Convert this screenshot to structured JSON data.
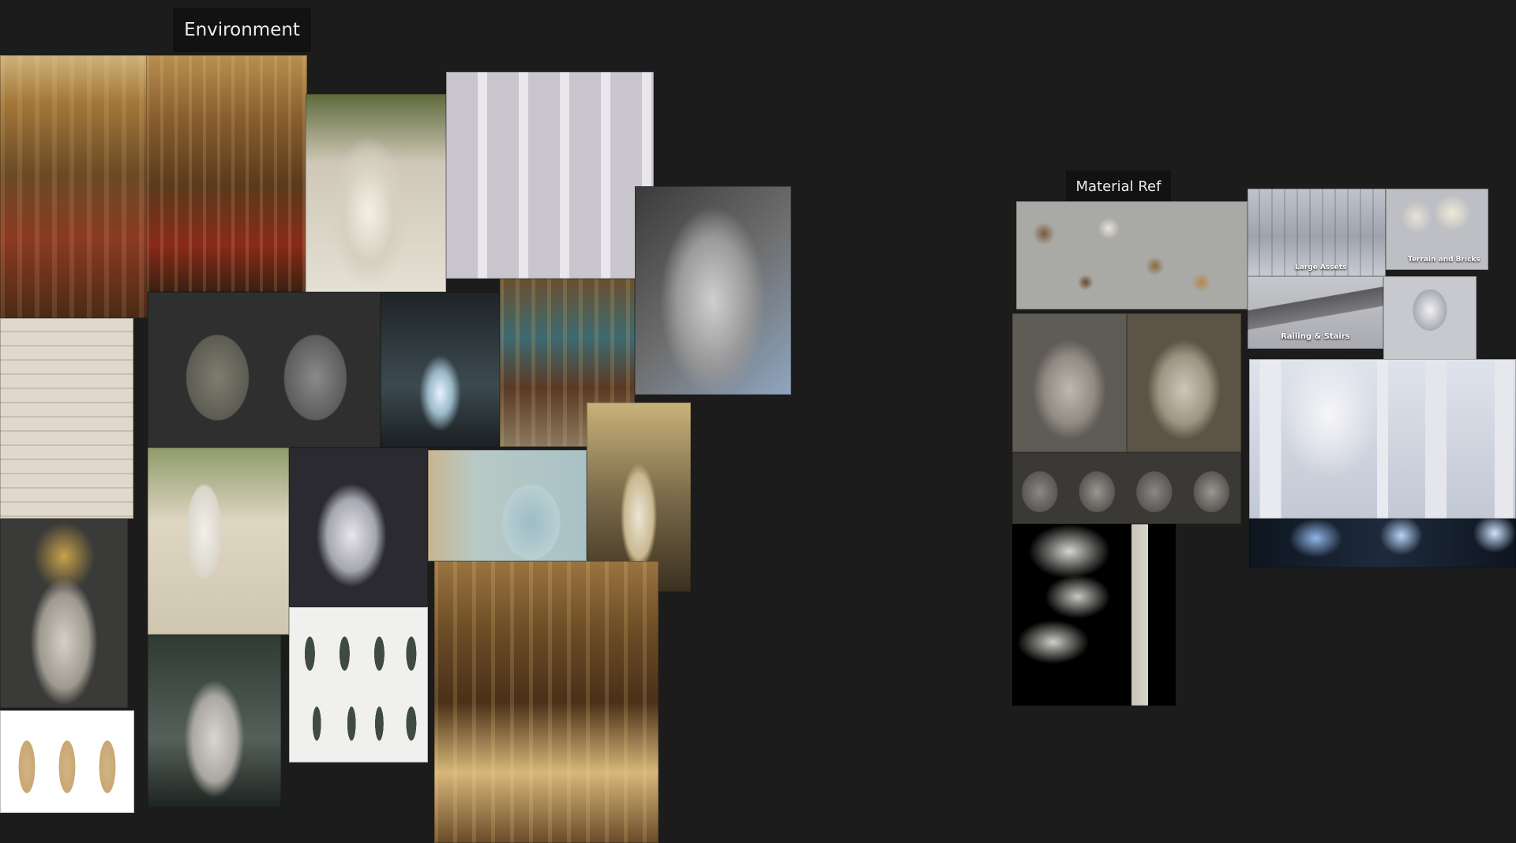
{
  "board": {
    "background": "#1c1c1c",
    "groups": [
      {
        "label": "Environment",
        "images": [
          {
            "name": "ornate-gold-hall-photo",
            "texture": "warm-hall"
          },
          {
            "name": "gilded-bar-hall-photo",
            "texture": "gold-hall"
          },
          {
            "name": "marble-arch-ivy-photo",
            "texture": "marble-arch"
          },
          {
            "name": "relief-wall-lounge-photo",
            "texture": "relief-wall"
          },
          {
            "name": "cemetery-statue-photo",
            "texture": "cemetery-statue"
          },
          {
            "name": "gothic-niche-statue-photo",
            "texture": "gothic-niche"
          },
          {
            "name": "arch-niche-models-render",
            "texture": "arch-models"
          },
          {
            "name": "glowing-shrine-render",
            "texture": "ghost-shrine"
          },
          {
            "name": "restaurant-bar-interior-photo",
            "texture": "bar-interior"
          },
          {
            "name": "veiled-statue-shrine-photo",
            "texture": "veiled-statue"
          },
          {
            "name": "three-statues-render",
            "texture": "statue-row"
          },
          {
            "name": "garden-niche-statue-photo",
            "texture": "garden-niche"
          },
          {
            "name": "crowned-sculpt-render",
            "texture": "dark-sculpt"
          },
          {
            "name": "statue-sketch-sheet",
            "texture": "sketch-sheet"
          },
          {
            "name": "mint-arches-interior-photo",
            "texture": "mint-arches"
          },
          {
            "name": "ornate-nook-photo",
            "texture": "ornate-nook"
          },
          {
            "name": "cloaked-statue-render",
            "texture": "cloaked-statue"
          },
          {
            "name": "long-dining-hall-photo",
            "texture": "dining-hall"
          }
        ]
      },
      {
        "label": "Material Ref",
        "images": [
          {
            "name": "furniture-props-kit-render",
            "texture": "furniture-kit"
          },
          {
            "name": "large-assets-kit-render",
            "texture": "grey-blockout",
            "caption": "Large Assets"
          },
          {
            "name": "terrain-bricks-kit-render",
            "texture": "rubble-kit",
            "caption": "Terrain and Bricks"
          },
          {
            "name": "railing-stairs-kit-render",
            "texture": "rail-kit",
            "caption": "Railing & Stairs"
          },
          {
            "name": "arch-piece-render",
            "texture": "arch-piece"
          },
          {
            "name": "stone-face-closeup-render",
            "texture": "stone-face"
          },
          {
            "name": "stone-crowned-face-render",
            "texture": "stone-face-2"
          },
          {
            "name": "hooded-heads-turnaround-render",
            "texture": "heads-row"
          },
          {
            "name": "white-arches-modular-render",
            "texture": "white-arches"
          },
          {
            "name": "ornament-column-kit-render",
            "texture": "ornament-kit"
          },
          {
            "name": "dark-corridor-lighting-render",
            "texture": "dark-corridor"
          }
        ]
      }
    ]
  }
}
